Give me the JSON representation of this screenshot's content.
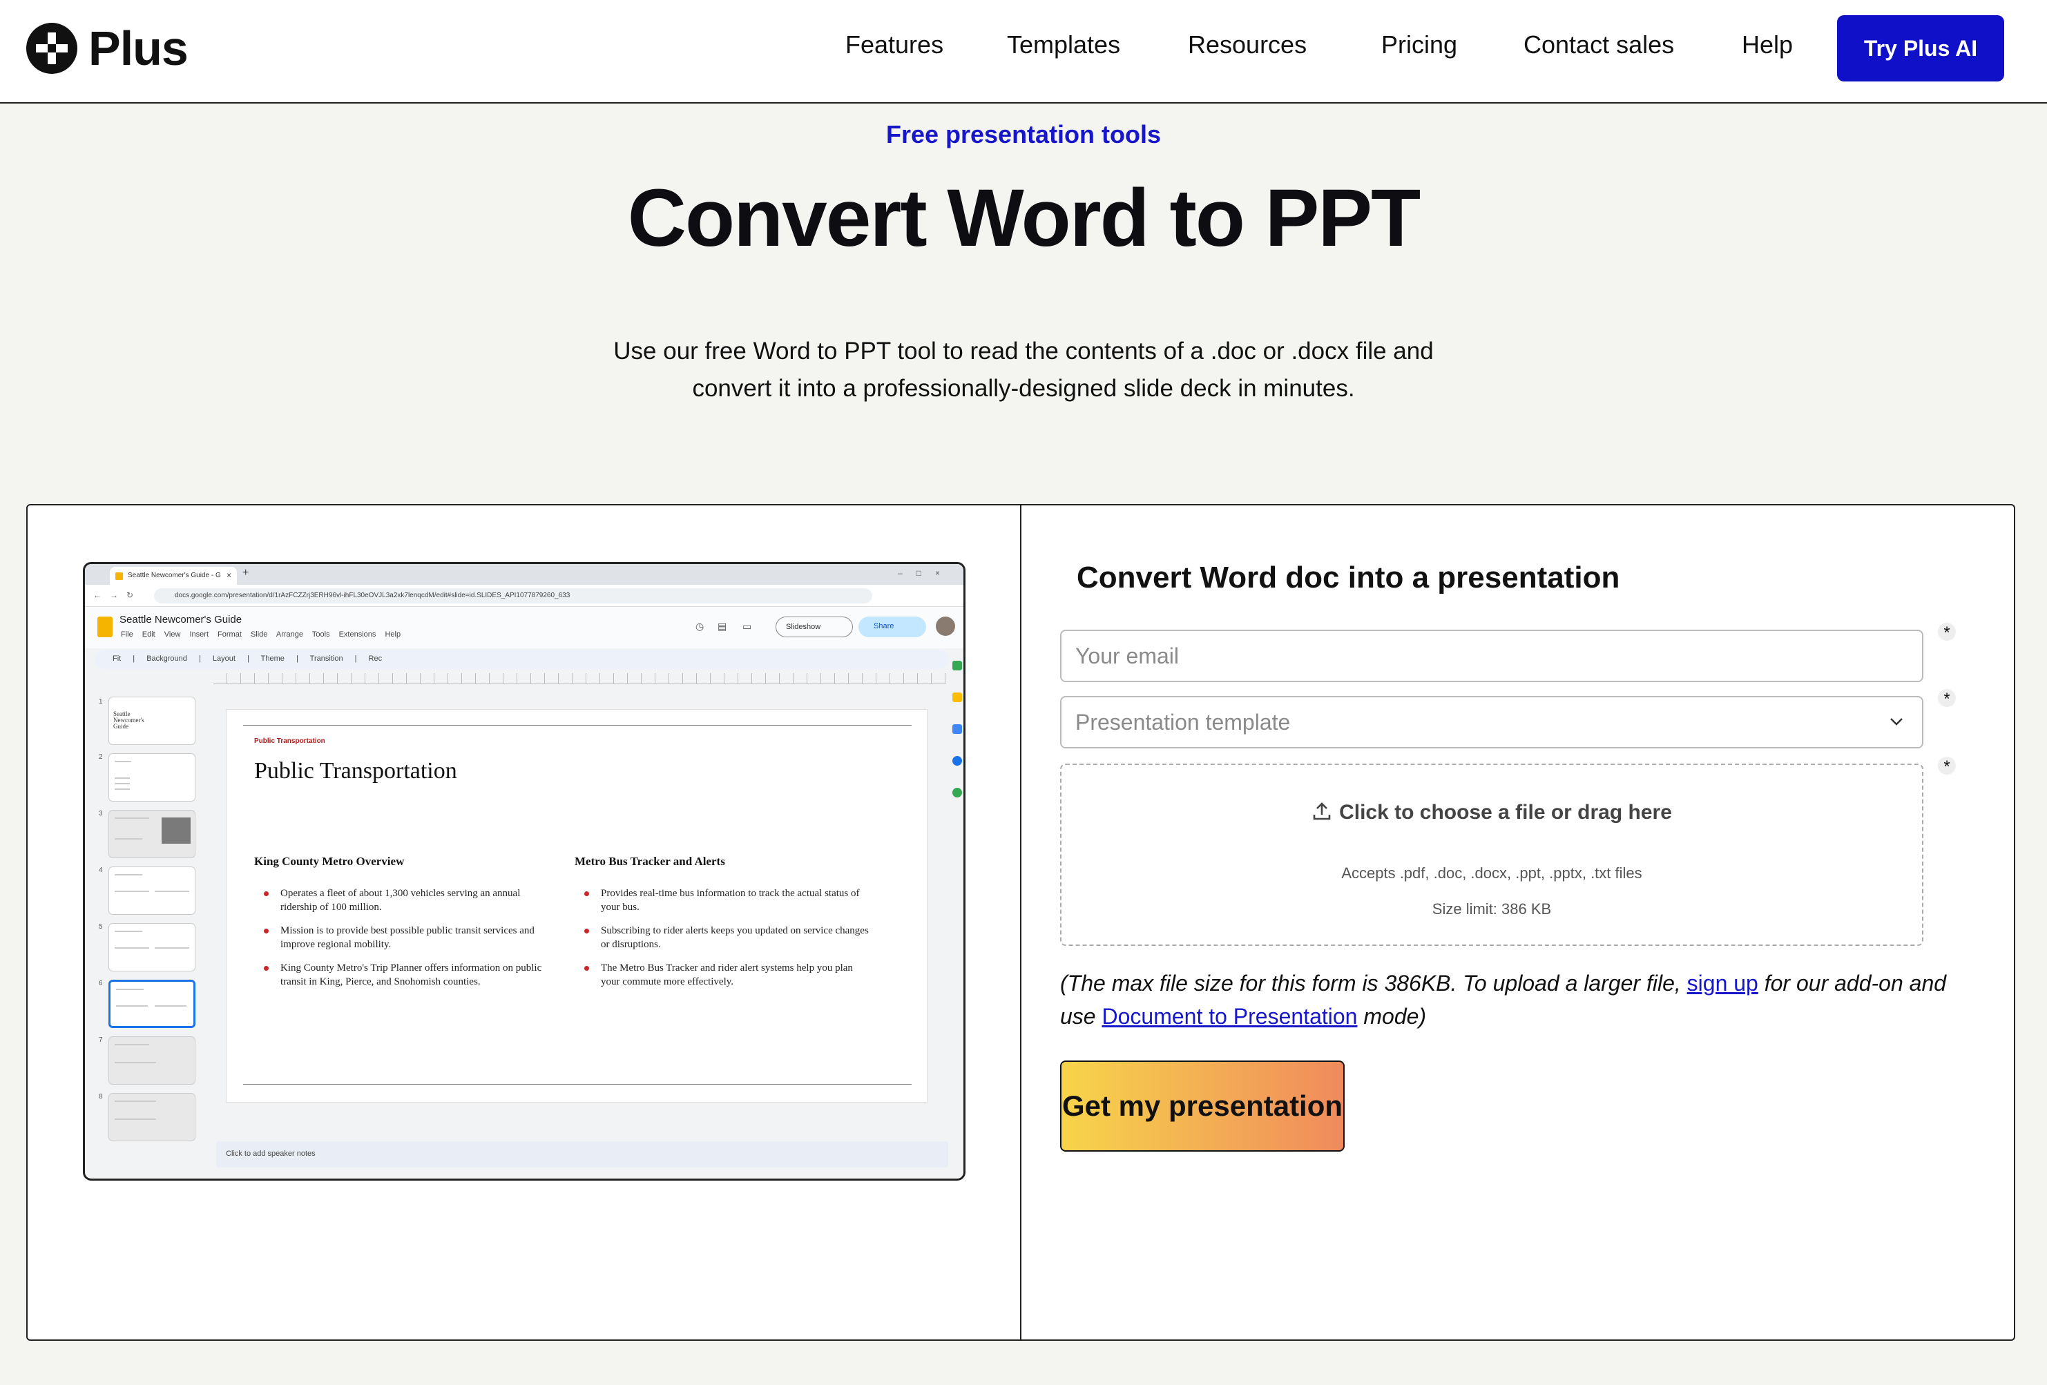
{
  "nav": {
    "logo_text": "Plus",
    "items": [
      "Features",
      "Templates",
      "Resources",
      "Pricing",
      "Contact sales",
      "Help"
    ],
    "cta": "Try Plus AI",
    "brand_color": "#1010c8"
  },
  "hero": {
    "eyebrow": "Free presentation tools",
    "title": "Convert Word to PPT",
    "subtitle_line1": "Use our free Word to PPT tool to read the contents of a .doc or .docx file and",
    "subtitle_line2": "convert it into a professionally-designed slide deck in minutes."
  },
  "screenshot": {
    "tab_title": "Seattle Newcomer's Guide - G",
    "url": "docs.google.com/presentation/d/1rAzFCZZrj3ERH96vl-ihFL30eOVJL3a2xk7lenqcdM/edit#slide=id.SLIDES_API1077879260_633",
    "doc_title": "Seattle Newcomer's Guide",
    "menus": "File Edit View Insert Format Slide Arrange Tools Extensions Help",
    "slideshow": "Slideshow",
    "share": "Share",
    "toolbar": "Fit | Background | Layout | Theme | Transition | Rec",
    "thumb1_text": "Seattle Newcomer's Guide",
    "slide_numbers": [
      "1",
      "2",
      "3",
      "4",
      "5",
      "6",
      "7",
      "8"
    ],
    "slide": {
      "kicker": "Public Transportation",
      "title": "Public Transportation",
      "col1_heading": "King County Metro Overview",
      "col1_bullets": [
        "Operates a fleet of about 1,300 vehicles serving an annual ridership of 100 million.",
        "Mission is to provide best possible public transit services and improve regional mobility.",
        "King County Metro's Trip Planner offers information on public transit in King, Pierce, and Snohomish counties."
      ],
      "col2_heading": "Metro Bus Tracker and Alerts",
      "col2_bullets": [
        "Provides real-time bus information to track the actual status of your bus.",
        "Subscribing to rider alerts keeps you updated on service changes or disruptions.",
        "The Metro Bus Tracker and rider alert systems help you plan your commute more effectively."
      ]
    },
    "speaker_notes": "Click to add speaker notes"
  },
  "form": {
    "title": "Convert Word doc into a presentation",
    "email_placeholder": "Your email",
    "template_placeholder": "Presentation template",
    "required_marker": "*",
    "upload_label": "Click to choose a file or drag here",
    "accepts": "Accepts .pdf, .doc, .docx, .ppt, .pptx, .txt files",
    "size_limit": "Size limit: 386 KB",
    "note_part1": "(The max file size for this form is 386KB. To upload a larger file, ",
    "note_link1": "sign up",
    "note_part2": " for our add-on and use ",
    "note_link2": "Document to Presentation",
    "note_part3": " mode)",
    "submit": "Get my presentation"
  }
}
